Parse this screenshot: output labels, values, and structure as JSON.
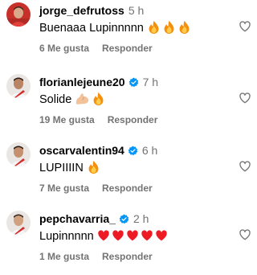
{
  "comments": [
    {
      "username": "jorge_defrutoss",
      "verified": false,
      "time": "5 h",
      "text": "Buenaaa Lupinnnnn",
      "emojis": [
        "fire-icon",
        "fire-icon",
        "fire-icon"
      ],
      "likes": "6 Me gusta",
      "reply_label": "Responder",
      "avatar_color": "#c8302a"
    },
    {
      "username": "florianlejeune20",
      "verified": true,
      "time": "7 h",
      "text": "Solide",
      "emojis": [
        "flexed-biceps-icon",
        "fire-icon"
      ],
      "likes": "19 Me gusta",
      "reply_label": "Responder",
      "avatar_color": "#e9e6e3"
    },
    {
      "username": "oscarvalentin94",
      "verified": true,
      "time": "6 h",
      "text": "LUPIIIIN",
      "emojis": [
        "fire-icon"
      ],
      "likes": "7 Me gusta",
      "reply_label": "Responder",
      "avatar_color": "#e9e6e3"
    },
    {
      "username": "pepchavarria_",
      "verified": true,
      "time": "2 h",
      "text": "Lupinnnnn",
      "emojis": [
        "red-heart-icon",
        "red-heart-icon",
        "red-heart-icon",
        "red-heart-icon",
        "red-heart-icon"
      ],
      "likes": "1 Me gusta",
      "reply_label": "Responder",
      "avatar_color": "#e9e6e3"
    }
  ],
  "colors": {
    "text_primary": "#000000",
    "text_secondary": "#737373",
    "verified_blue": "#0095f6",
    "heart_red": "#ed1c24",
    "fire_orange": "#f4900c",
    "background": "#ffffff"
  }
}
